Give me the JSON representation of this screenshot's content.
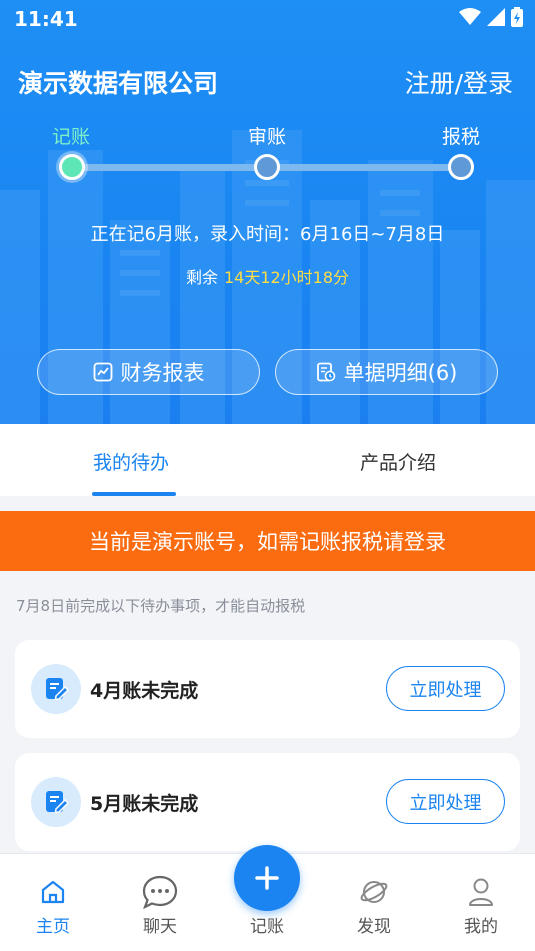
{
  "status_bar": {
    "time": "11:41"
  },
  "header": {
    "company": "演示数据有限公司",
    "login": "注册/登录"
  },
  "steps": [
    {
      "label": "记账",
      "active": true
    },
    {
      "label": "审账",
      "active": false
    },
    {
      "label": "报税",
      "active": false
    }
  ],
  "period": {
    "text": "正在记6月账，录入时间：6月16日~7月8日",
    "remain_label": "剩余",
    "remain_value": "14天12小时18分"
  },
  "actions": {
    "report": "财务报表",
    "detail": "单据明细(6)"
  },
  "tabs": {
    "todo": "我的待办",
    "intro": "产品介绍"
  },
  "banner": "当前是演示账号，如需记账报税请登录",
  "hint": "7月8日前完成以下待办事项，才能自动报税",
  "todos": [
    {
      "title": "4月账未完成",
      "button": "立即处理"
    },
    {
      "title": "5月账未完成",
      "button": "立即处理"
    }
  ],
  "tabbar": {
    "home": "主页",
    "chat": "聊天",
    "record": "记账",
    "discover": "发现",
    "mine": "我的"
  },
  "colors": {
    "primary": "#1b84f0",
    "banner": "#fb6b10",
    "highlight": "#ffdd44",
    "active_step": "#7cf0cb"
  },
  "icons": [
    "wifi-icon",
    "signal-icon",
    "battery-icon",
    "chart-report-icon",
    "receipt-icon",
    "edit-document-icon",
    "home-icon",
    "chat-bubble-icon",
    "plus-icon",
    "planet-icon",
    "user-icon"
  ]
}
